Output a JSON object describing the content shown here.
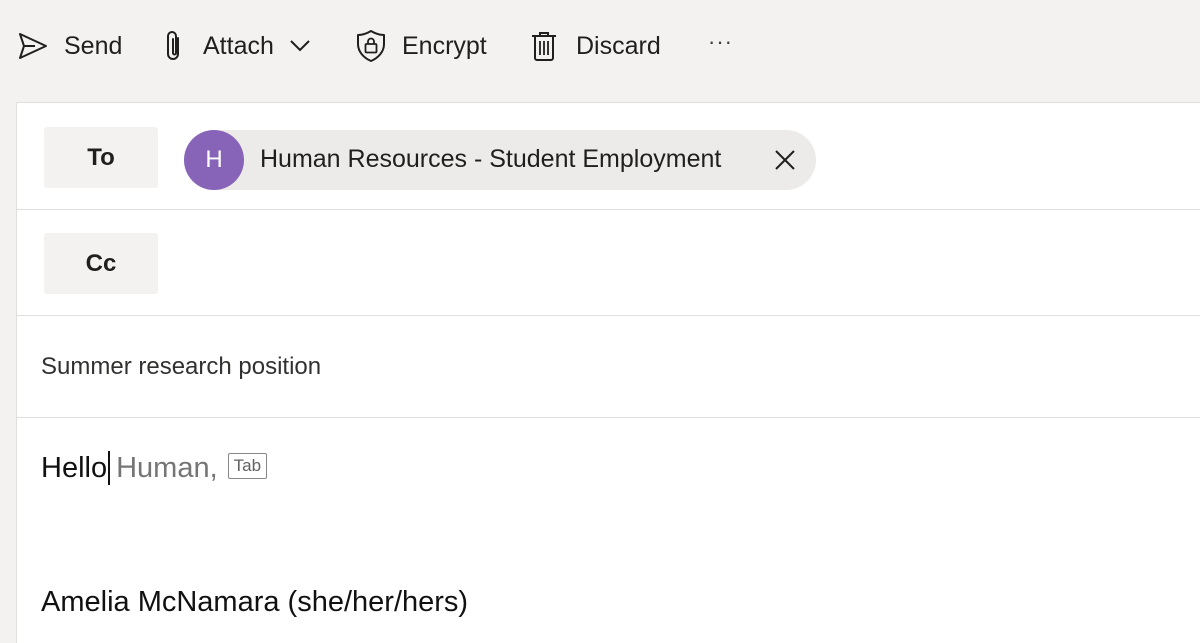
{
  "toolbar": {
    "send": {
      "label": "Send",
      "icon": "send-icon"
    },
    "attach": {
      "label": "Attach",
      "icon": "paperclip-icon"
    },
    "encrypt": {
      "label": "Encrypt",
      "icon": "shield-lock-icon"
    },
    "discard": {
      "label": "Discard",
      "icon": "trash-icon"
    },
    "more": {
      "label": "···",
      "icon": "more-icon"
    }
  },
  "compose": {
    "to_label": "To",
    "cc_label": "Cc",
    "recipients": [
      {
        "initial": "H",
        "name": "Human Resources - Student Employment",
        "avatar_color": "#8764b8"
      }
    ],
    "subject": "Summer research position",
    "body": {
      "typed": "Hello",
      "suggestion": "Human,",
      "suggestion_hint": "Tab",
      "signature": "Amelia McNamara (she/her/hers)"
    }
  },
  "colors": {
    "toolbar_bg": "#f3f2f1",
    "compose_bg": "#ffffff",
    "avatar": "#8764b8",
    "pill_bg": "#edebe9"
  }
}
